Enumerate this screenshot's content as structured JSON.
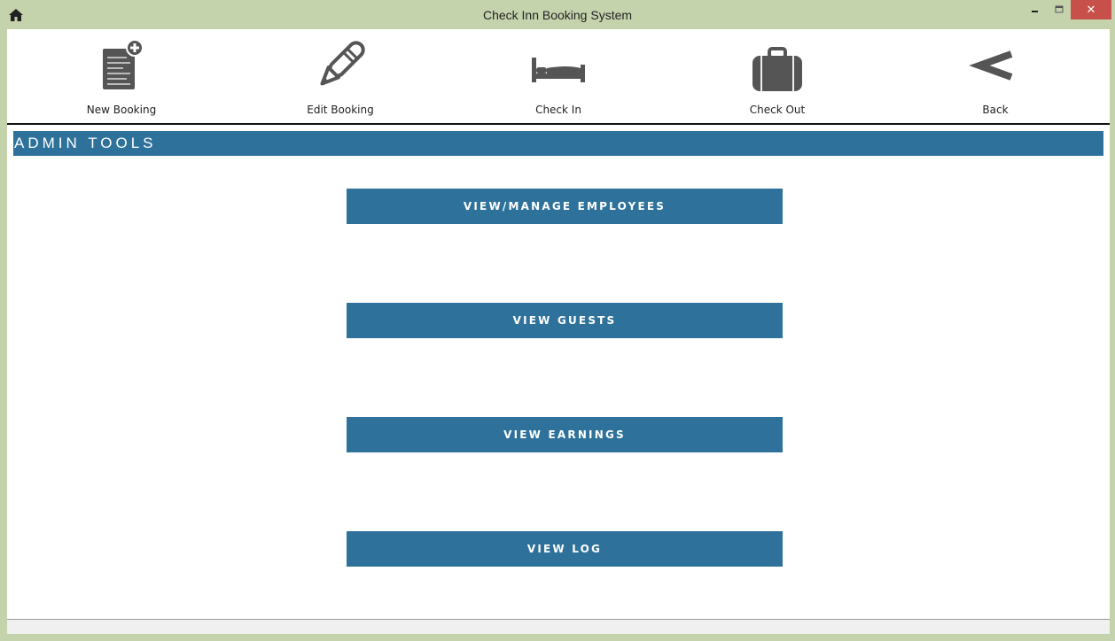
{
  "window": {
    "title": "Check Inn Booking System",
    "close_glyph": "✕"
  },
  "toolbar": {
    "items": [
      {
        "label": "New Booking",
        "icon": "new-booking-icon"
      },
      {
        "label": "Edit Booking",
        "icon": "pencil-icon"
      },
      {
        "label": "Check In",
        "icon": "bed-icon"
      },
      {
        "label": "Check Out",
        "icon": "suitcase-icon"
      },
      {
        "label": "Back",
        "icon": "back-chevron-icon"
      }
    ]
  },
  "section": {
    "title": "ADMIN TOOLS"
  },
  "admin_buttons": [
    {
      "label": "VIEW/MANAGE EMPLOYEES"
    },
    {
      "label": "VIEW GUESTS"
    },
    {
      "label": "VIEW EARNINGS"
    },
    {
      "label": "VIEW LOG"
    }
  ],
  "colors": {
    "accent": "#2e729b",
    "frame": "#c5d3ad",
    "close": "#c7504a",
    "icon": "#555555"
  }
}
